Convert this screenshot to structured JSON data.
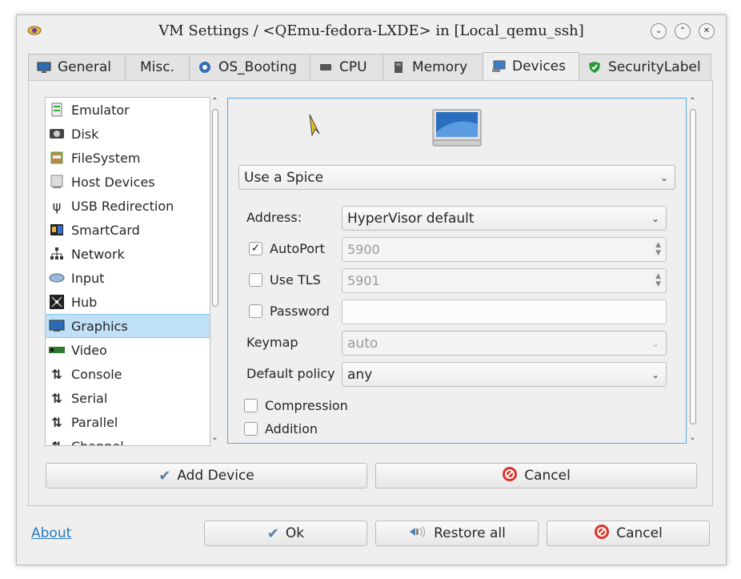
{
  "window": {
    "title": "VM Settings / <QEmu-fedora-LXDE> in [Local_qemu_ssh]",
    "controls": [
      "minimize",
      "maximize",
      "close"
    ]
  },
  "tabs": [
    {
      "label": "General",
      "icon": "monitor-icon"
    },
    {
      "label": "Misc.",
      "icon": ""
    },
    {
      "label": "OS_Booting",
      "icon": "boot-icon"
    },
    {
      "label": "CPU",
      "icon": "cpu-icon"
    },
    {
      "label": "Memory",
      "icon": "memory-icon"
    },
    {
      "label": "Devices",
      "icon": "devices-icon",
      "active": true
    },
    {
      "label": "SecurityLabel",
      "icon": "shield-icon"
    }
  ],
  "devices": {
    "items": [
      {
        "label": "Emulator",
        "icon": "emulator-icon"
      },
      {
        "label": "Disk",
        "icon": "disk-icon"
      },
      {
        "label": "FileSystem",
        "icon": "filesystem-icon"
      },
      {
        "label": "Host Devices",
        "icon": "host-devices-icon"
      },
      {
        "label": "USB Redirection",
        "icon": "usb-icon"
      },
      {
        "label": "SmartCard",
        "icon": "smartcard-icon"
      },
      {
        "label": "Network",
        "icon": "network-icon"
      },
      {
        "label": "Input",
        "icon": "input-icon"
      },
      {
        "label": "Hub",
        "icon": "hub-icon"
      },
      {
        "label": "Graphics",
        "icon": "graphics-icon",
        "selected": true
      },
      {
        "label": "Video",
        "icon": "video-icon"
      },
      {
        "label": "Console",
        "icon": "arrows-icon"
      },
      {
        "label": "Serial",
        "icon": "arrows-icon"
      },
      {
        "label": "Parallel",
        "icon": "arrows-icon"
      },
      {
        "label": "Channel",
        "icon": "arrows-icon"
      }
    ]
  },
  "graphics": {
    "type_select": "Use a Spice",
    "address_label": "Address:",
    "address_value": "HyperVisor default",
    "autoport_label": "AutoPort",
    "autoport_checked": true,
    "autoport_value": "5900",
    "tls_label": "Use TLS",
    "tls_checked": false,
    "tls_value": "5901",
    "password_label": "Password",
    "password_checked": false,
    "password_value": "",
    "keymap_label": "Keymap",
    "keymap_value": "auto",
    "policy_label": "Default policy",
    "policy_value": "any",
    "compression_label": "Compression",
    "compression_checked": false,
    "addition_label": "Addition",
    "addition_checked": false
  },
  "panel_buttons": {
    "add_device": "Add Device",
    "cancel": "Cancel"
  },
  "footer": {
    "about": "About",
    "ok": "Ok",
    "restore_all": "Restore all",
    "cancel": "Cancel"
  },
  "colors": {
    "accent": "#56a9df",
    "selection": "#bfe0f7",
    "link": "#2a7ab8",
    "cancel_red": "#d9342b"
  }
}
